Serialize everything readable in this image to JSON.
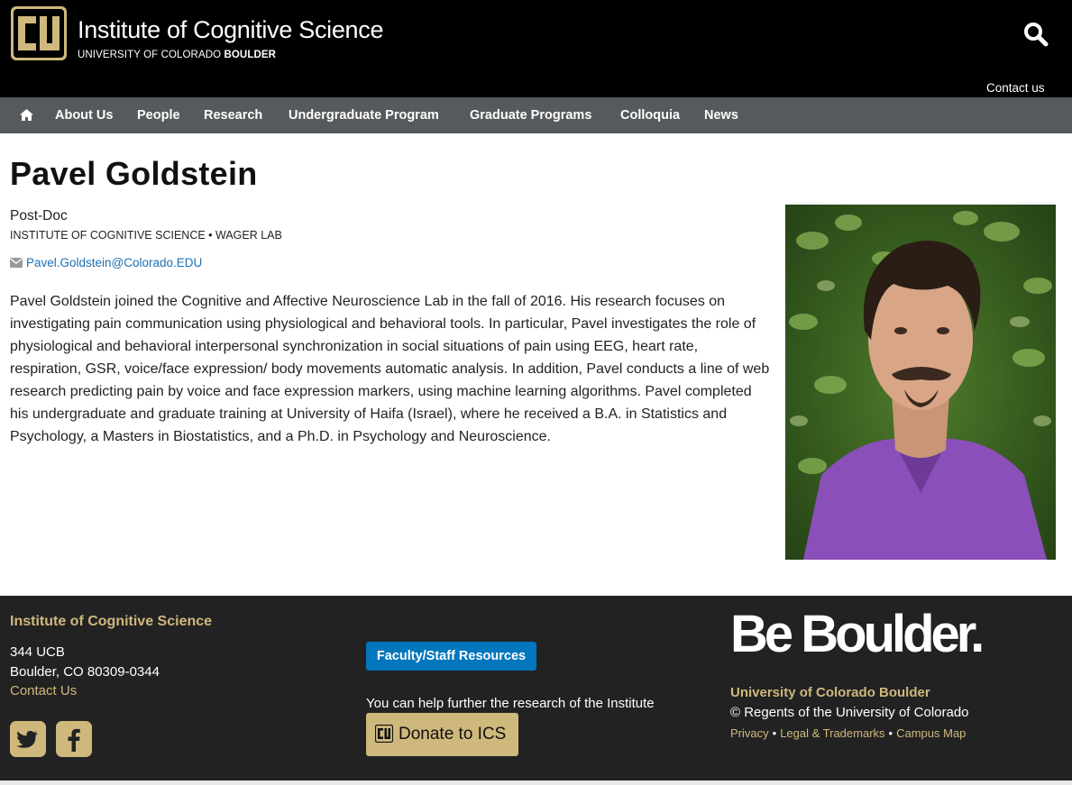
{
  "header": {
    "title": "Institute of Cognitive Science",
    "subtitle_prefix": "UNIVERSITY OF COLORADO ",
    "subtitle_bold": "BOULDER",
    "contact": "Contact us"
  },
  "nav": {
    "items": [
      "About Us",
      "People",
      "Research",
      "Undergraduate Program",
      "Graduate Programs",
      "Colloquia",
      "News"
    ]
  },
  "profile": {
    "name": "Pavel Goldstein",
    "role": "Post-Doc",
    "affiliation": "INSTITUTE OF COGNITIVE SCIENCE • WAGER LAB",
    "email": "Pavel.Goldstein@Colorado.EDU",
    "bio": "Pavel Goldstein joined the Cognitive and Affective Neuroscience Lab in the fall of 2016.  His research focuses on investigating pain communication using physiological  and behavioral tools. In particular, Pavel investigates the role of physiological  and behavioral interpersonal synchronization in social situations of pain  using EEG, heart rate, respiration, GSR, voice/face expression/ body movements automatic analysis. In addition, Pavel conducts a line of web research predicting pain by voice and face expression markers, using machine learning algorithms. Pavel completed his undergraduate and graduate training at University of Haifa (Israel), where he received a B.A. in Statistics and Psychology, a Masters in Biostatistics, and a Ph.D. in Psychology and Neuroscience."
  },
  "footer": {
    "title": "Institute of Cognitive Science",
    "address_line1": "344 UCB",
    "address_line2": "Boulder, CO  80309-0344",
    "contact": "Contact Us",
    "resources_button": "Faculty/Staff Resources",
    "help_text": "You can help further the research of the Institute",
    "donate_button": "Donate to ICS",
    "be_boulder": "Be Boulder.",
    "university": "University of Colorado Boulder",
    "regents": "© Regents of the University of Colorado",
    "links": [
      "Privacy",
      "Legal & Trademarks",
      "Campus Map"
    ]
  },
  "colors": {
    "gold": "#cfb87c",
    "nav_gray": "#565a5c",
    "footer_dark": "#222222",
    "link_blue": "#1f6fb0",
    "button_blue": "#0277bd"
  },
  "icons": [
    "cu-logo-icon",
    "search-icon",
    "home-icon",
    "envelope-icon",
    "twitter-icon",
    "facebook-icon",
    "cu-small-logo-icon"
  ]
}
